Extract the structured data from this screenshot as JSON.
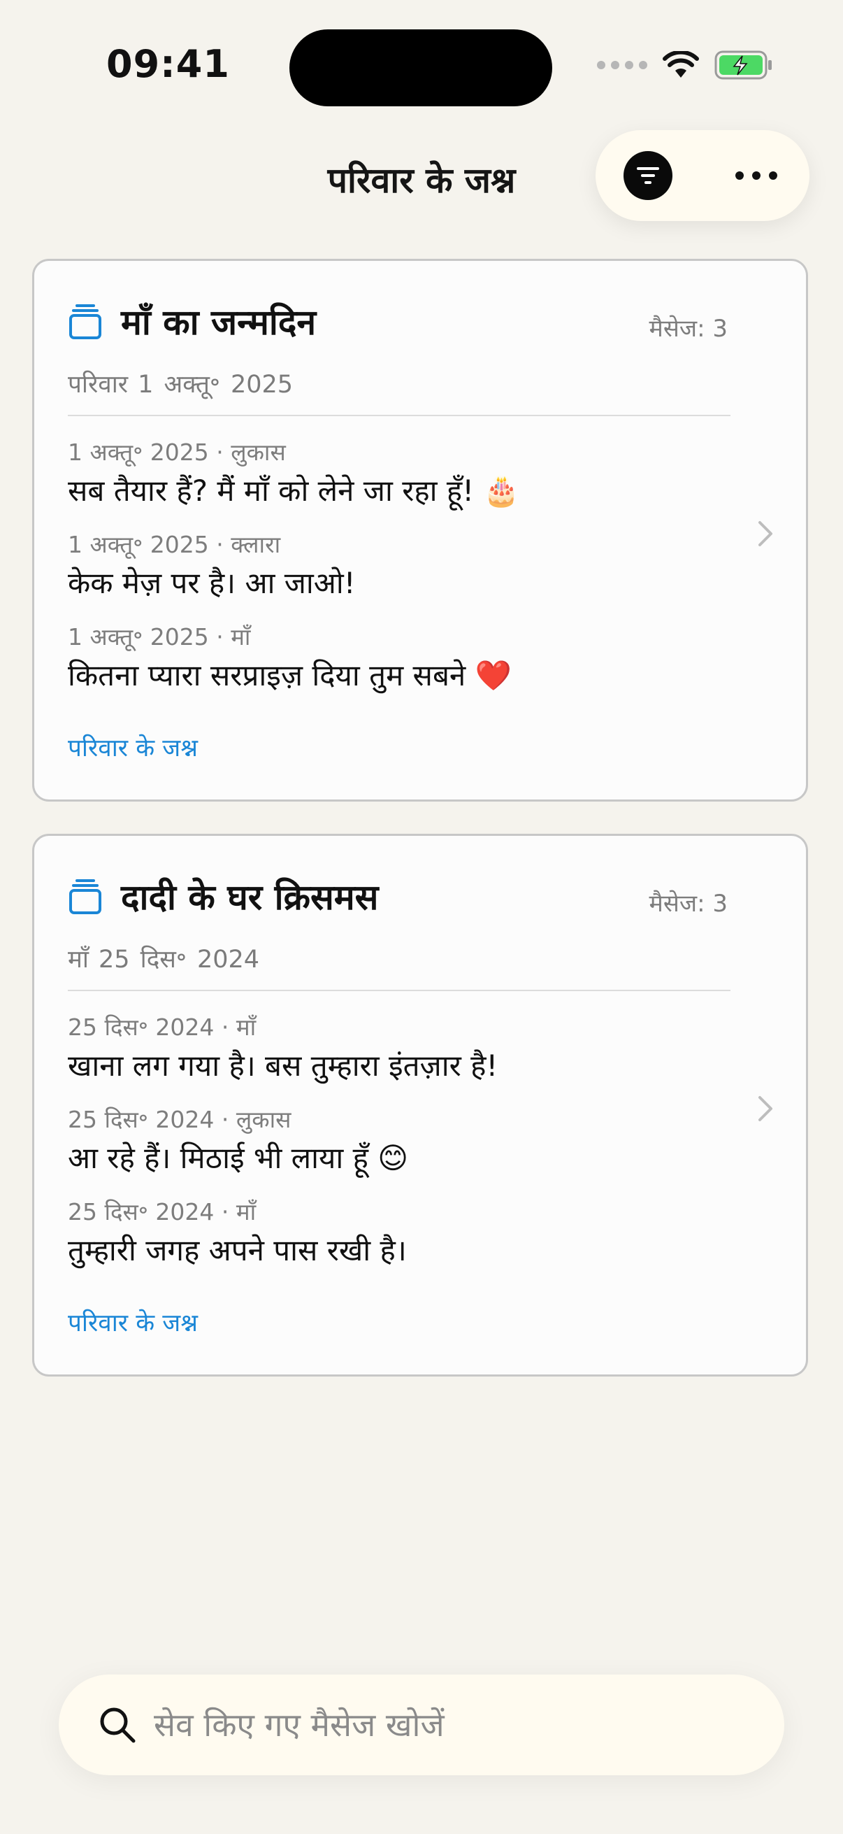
{
  "status_bar": {
    "time": "09:41"
  },
  "header": {
    "title": "परिवार के जश्न"
  },
  "cards": [
    {
      "title": "माँ का जन्मदिन",
      "message_count": "मैसेज: 3",
      "author": "परिवार",
      "date": "1 अक्तू॰ 2025",
      "messages": [
        {
          "meta": "1 अक्तू॰ 2025 · लुकास",
          "text": "सब तैयार हैं? मैं माँ को लेने जा रहा हूँ! 🎂"
        },
        {
          "meta": "1 अक्तू॰ 2025 · क्लारा",
          "text": "केक मेज़ पर है। आ जाओ!"
        },
        {
          "meta": "1 अक्तू॰ 2025 · माँ",
          "text": "कितना प्यारा सरप्राइज़ दिया तुम सबने ❤️"
        }
      ],
      "link": "परिवार के जश्न"
    },
    {
      "title": "दादी के घर क्रिसमस",
      "message_count": "मैसेज: 3",
      "author": "माँ",
      "date": "25 दिस॰ 2024",
      "messages": [
        {
          "meta": "25 दिस॰ 2024 · माँ",
          "text": "खाना लग गया है। बस तुम्हारा इंतज़ार है!"
        },
        {
          "meta": "25 दिस॰ 2024 · लुकास",
          "text": "आ रहे हैं। मिठाई भी लाया हूँ 😊"
        },
        {
          "meta": "25 दिस॰ 2024 · माँ",
          "text": "तुम्हारी जगह अपने पास रखी है।"
        }
      ],
      "link": "परिवार के जश्न"
    }
  ],
  "search": {
    "placeholder": "सेव किए गए मैसेज खोजें"
  },
  "colors": {
    "accent": "#1a86d6",
    "background": "#f5f3ed",
    "battery": "#4cd964"
  },
  "icons": {
    "card": "stack-icon",
    "filter": "filter-icon",
    "more": "ellipsis-icon",
    "chevron": "chevron-right-icon",
    "search": "search-icon"
  }
}
